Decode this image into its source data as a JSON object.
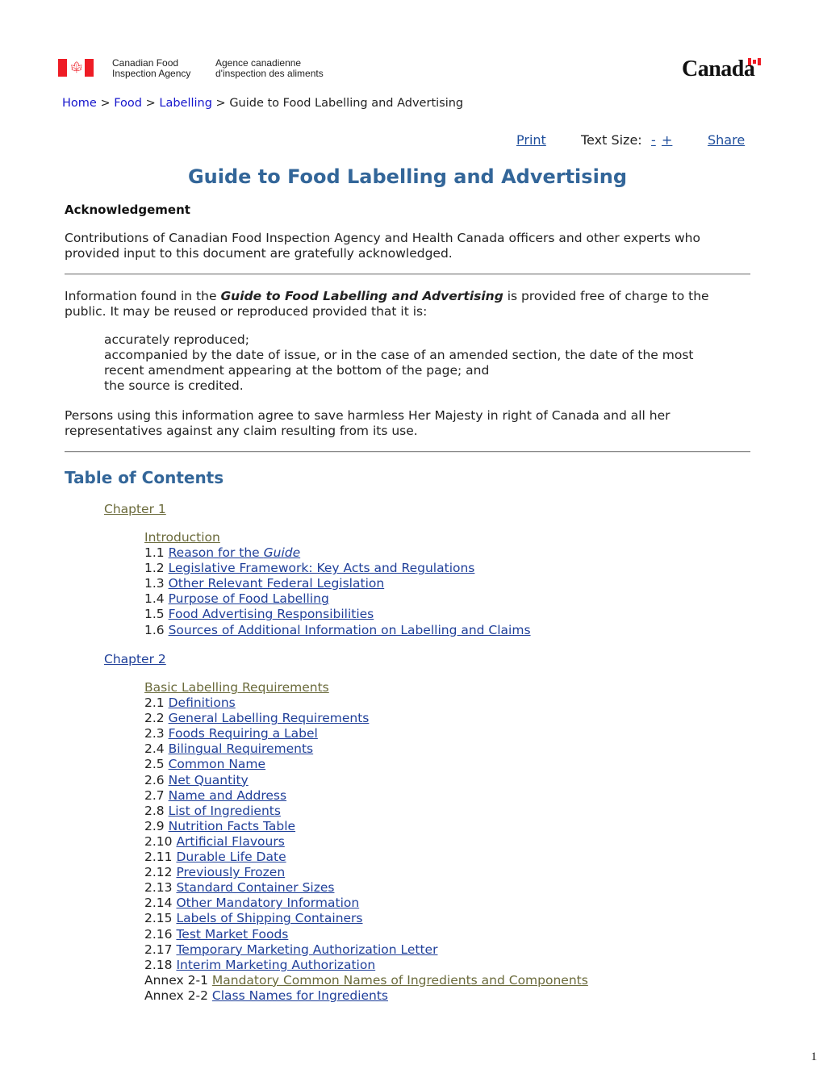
{
  "header": {
    "agency_en_line1": "Canadian Food",
    "agency_en_line2": "Inspection Agency",
    "agency_fr_line1": "Agence canadienne",
    "agency_fr_line2": "d'inspection des aliments",
    "wordmark": "Canada",
    "flag_glyph": "✦"
  },
  "breadcrumb": {
    "items": [
      {
        "label": "Home",
        "link": true
      },
      {
        "label": "Food",
        "link": true
      },
      {
        "label": "Labelling",
        "link": true
      },
      {
        "label": "Guide to Food Labelling and Advertising",
        "link": false
      }
    ],
    "separator": ">"
  },
  "toolbar": {
    "print_label": "Print",
    "text_size_label": "Text Size:",
    "decrease_label": "-",
    "increase_label": "+",
    "share_label": "Share"
  },
  "title": "Guide to Food Labelling and Advertising",
  "acknowledgement": {
    "heading": "Acknowledgement",
    "text": "Contributions of Canadian Food Inspection Agency and Health Canada officers and other experts who provided input to this document are gratefully acknowledged."
  },
  "information": {
    "text_before": "Information found in the ",
    "emphasis": "Guide to Food Labelling and Advertising",
    "text_after": " is provided free of charge to the public. It may be reused or reproduced provided that it is:",
    "conditions": [
      "accurately reproduced;",
      "accompanied by the date of issue, or in the case of an amended section, the date of the most recent amendment appearing at the bottom of the page; and",
      "the source is credited."
    ],
    "persons_text": "Persons using this information agree to save harmless Her Majesty in right of Canada and all her representatives against any claim resulting from its use."
  },
  "toc": {
    "heading": "Table of Contents",
    "chapters": [
      {
        "label": "Chapter 1",
        "section_title": "Introduction",
        "items": [
          {
            "num": "1.1",
            "label": "Reason for the ",
            "label_italic": "Guide"
          },
          {
            "num": "1.2",
            "label": "Legislative Framework: Key Acts and Regulations"
          },
          {
            "num": "1.3",
            "label": "Other Relevant Federal Legislation"
          },
          {
            "num": "1.4",
            "label": "Purpose of Food Labelling"
          },
          {
            "num": "1.5",
            "label": "Food Advertising Responsibilities"
          },
          {
            "num": "1.6",
            "label": "Sources of Additional Information on Labelling and Claims"
          }
        ]
      },
      {
        "label": "Chapter 2",
        "section_title": "Basic Labelling Requirements",
        "items": [
          {
            "num": "2.1",
            "label": "Definitions"
          },
          {
            "num": "2.2",
            "label": "General Labelling Requirements"
          },
          {
            "num": "2.3",
            "label": "Foods Requiring a Label"
          },
          {
            "num": "2.4",
            "label": "Bilingual Requirements"
          },
          {
            "num": "2.5",
            "label": "Common Name"
          },
          {
            "num": "2.6",
            "label": "Net Quantity"
          },
          {
            "num": "2.7",
            "label": "Name and Address"
          },
          {
            "num": "2.8",
            "label": "List of Ingredients"
          },
          {
            "num": "2.9",
            "label": "Nutrition Facts Table"
          },
          {
            "num": "2.10",
            "label": "Artificial Flavours"
          },
          {
            "num": "2.11",
            "label": "Durable Life Date"
          },
          {
            "num": "2.12",
            "label": "Previously Frozen"
          },
          {
            "num": "2.13",
            "label": "Standard Container Sizes"
          },
          {
            "num": "2.14",
            "label": "Other Mandatory Information"
          },
          {
            "num": "2.15",
            "label": "Labels of Shipping Containers"
          },
          {
            "num": "2.16",
            "label": "Test Market Foods"
          },
          {
            "num": "2.17",
            "label": "Temporary Marketing Authorization Letter"
          },
          {
            "num": "2.18",
            "label": "Interim Marketing Authorization"
          },
          {
            "num": "Annex 2-1",
            "label": "Mandatory Common Names of Ingredients and Components",
            "visited": true
          },
          {
            "num": "Annex 2-2",
            "label": "Class Names for Ingredients"
          }
        ]
      }
    ]
  },
  "page_number": "1",
  "colors": {
    "heading_blue": "#336699",
    "link_blue": "#1f3f99",
    "visited_olive": "#6b6b3c",
    "flag_red": "#ee1c25"
  }
}
